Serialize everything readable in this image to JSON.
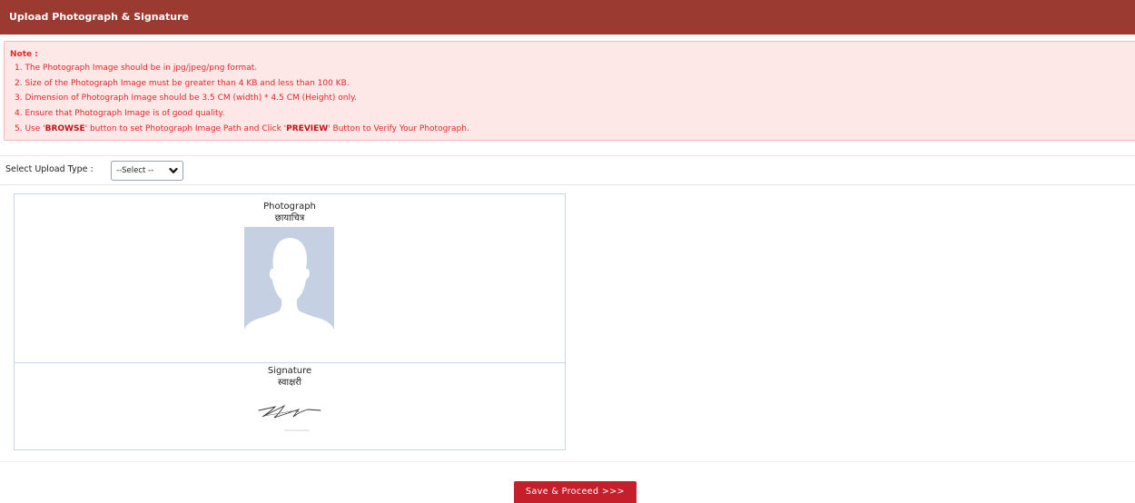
{
  "header": {
    "title": "Upload Photograph & Signature"
  },
  "note": {
    "title": "Note :",
    "lines": [
      {
        "text": "1. The Photograph Image should be in jpg/jpeg/png format."
      },
      {
        "text": "2. Size of the Photograph Image must be greater than 4 KB and less than 100 KB."
      },
      {
        "text": "3. Dimension of Photograph Image should be 3.5 CM (width) * 4.5 CM (Height) only."
      },
      {
        "text": "4. Ensure that Photograph Image is of good quality."
      },
      {
        "pre": "5. Use '",
        "b1": "BROWSE",
        "mid": "' button to set Photograph Image Path and Click '",
        "b2": "PREVIEW",
        "post": "' Button to Verify Your Photograph."
      }
    ]
  },
  "upload_type": {
    "label": "Select Upload Type :",
    "selected": "--Select --"
  },
  "photo": {
    "title": "Photograph",
    "title_hindi": "छायाचित्र"
  },
  "signature": {
    "title": "Signature",
    "title_hindi": "स्वाक्षरी"
  },
  "actions": {
    "save_label": "Save & Proceed >>>"
  },
  "colors": {
    "header_bg": "#9b3a31",
    "note_bg": "#fde7e7",
    "note_text": "#e5272a",
    "button_bg": "#c41f2a"
  }
}
